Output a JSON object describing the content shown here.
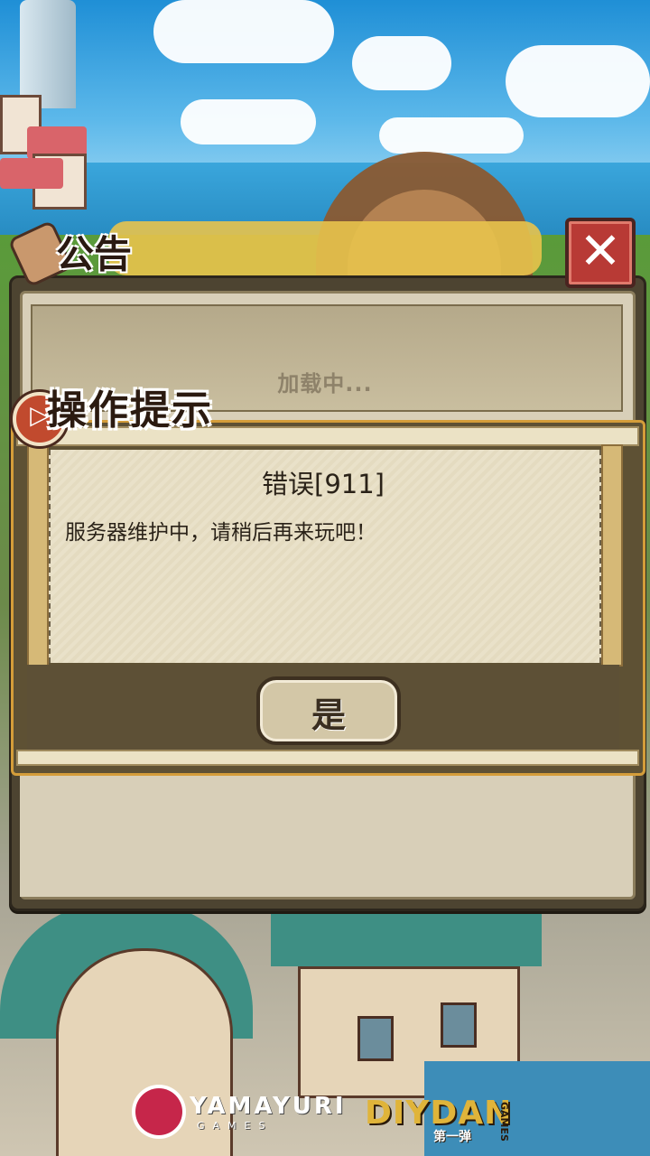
{
  "announcement": {
    "title": "公告",
    "loading_text": "加载中..."
  },
  "dialog": {
    "title": "操作提示",
    "heading": "错误[911]",
    "message": "服务器维护中，请稍后再来玩吧！",
    "confirm_label": "是"
  },
  "logos": {
    "publisher": "YAMAYURI",
    "publisher_sub": "GAMES",
    "developer": "DIYDAN",
    "developer_sub": "第一弹",
    "developer_side": "GAMES"
  },
  "colors": {
    "frame_dark": "#4d4431",
    "parchment": "#e9e1c9",
    "close_red": "#b83a35",
    "accent_gold": "#d49d3a"
  },
  "icons": {
    "close": "close-x-icon",
    "scroll": "scroll-icon",
    "tip_badge": "arrow-badge-icon"
  }
}
